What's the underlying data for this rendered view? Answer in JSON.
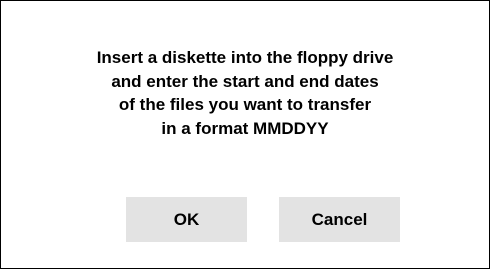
{
  "dialog": {
    "message_lines": [
      "Insert a diskette into the floppy drive",
      "and enter the start and end dates",
      "of the files you want to transfer",
      "in a format MMDDYY"
    ],
    "ok_label": "OK",
    "cancel_label": "Cancel"
  },
  "colors": {
    "background": "#ffffff",
    "border": "#000000",
    "button_background": "#e3e3e3",
    "text": "#000000"
  }
}
